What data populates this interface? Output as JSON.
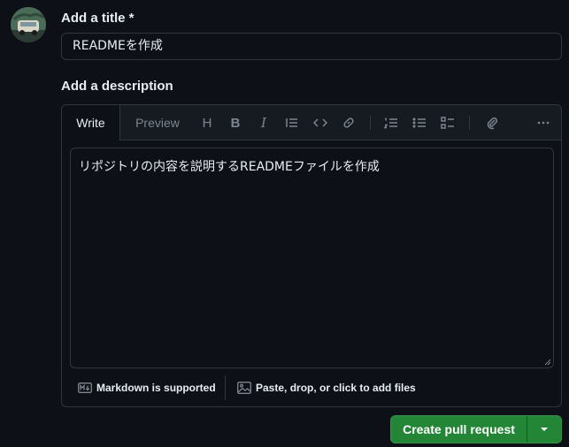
{
  "form": {
    "title_label": "Add a title *",
    "title_value": "READMEを作成",
    "description_label": "Add a description"
  },
  "editor": {
    "tabs": [
      {
        "label": "Write",
        "active": true
      },
      {
        "label": "Preview",
        "active": false
      }
    ],
    "toolbar": {
      "heading": "H",
      "bold": "B",
      "italic": "I"
    },
    "body": "リポジトリの内容を説明するREADMEファイルを作成",
    "footer": {
      "markdown_label": "Markdown is supported",
      "attach_label": "Paste, drop, or click to add files"
    }
  },
  "actions": {
    "primary_label": "Create pull request"
  },
  "colors": {
    "background": "#0d1117",
    "border": "#30363d",
    "header": "#161b22",
    "text": "#e6edf3",
    "muted": "#7d8590",
    "primary": "#238636"
  },
  "icons": [
    "avatar",
    "quote-icon",
    "code-icon",
    "link-icon",
    "ordered-list-icon",
    "unordered-list-icon",
    "task-list-icon",
    "paperclip-icon",
    "kebab-icon",
    "markdown-icon",
    "image-icon",
    "triangle-down-icon",
    "resize-handle-icon"
  ]
}
